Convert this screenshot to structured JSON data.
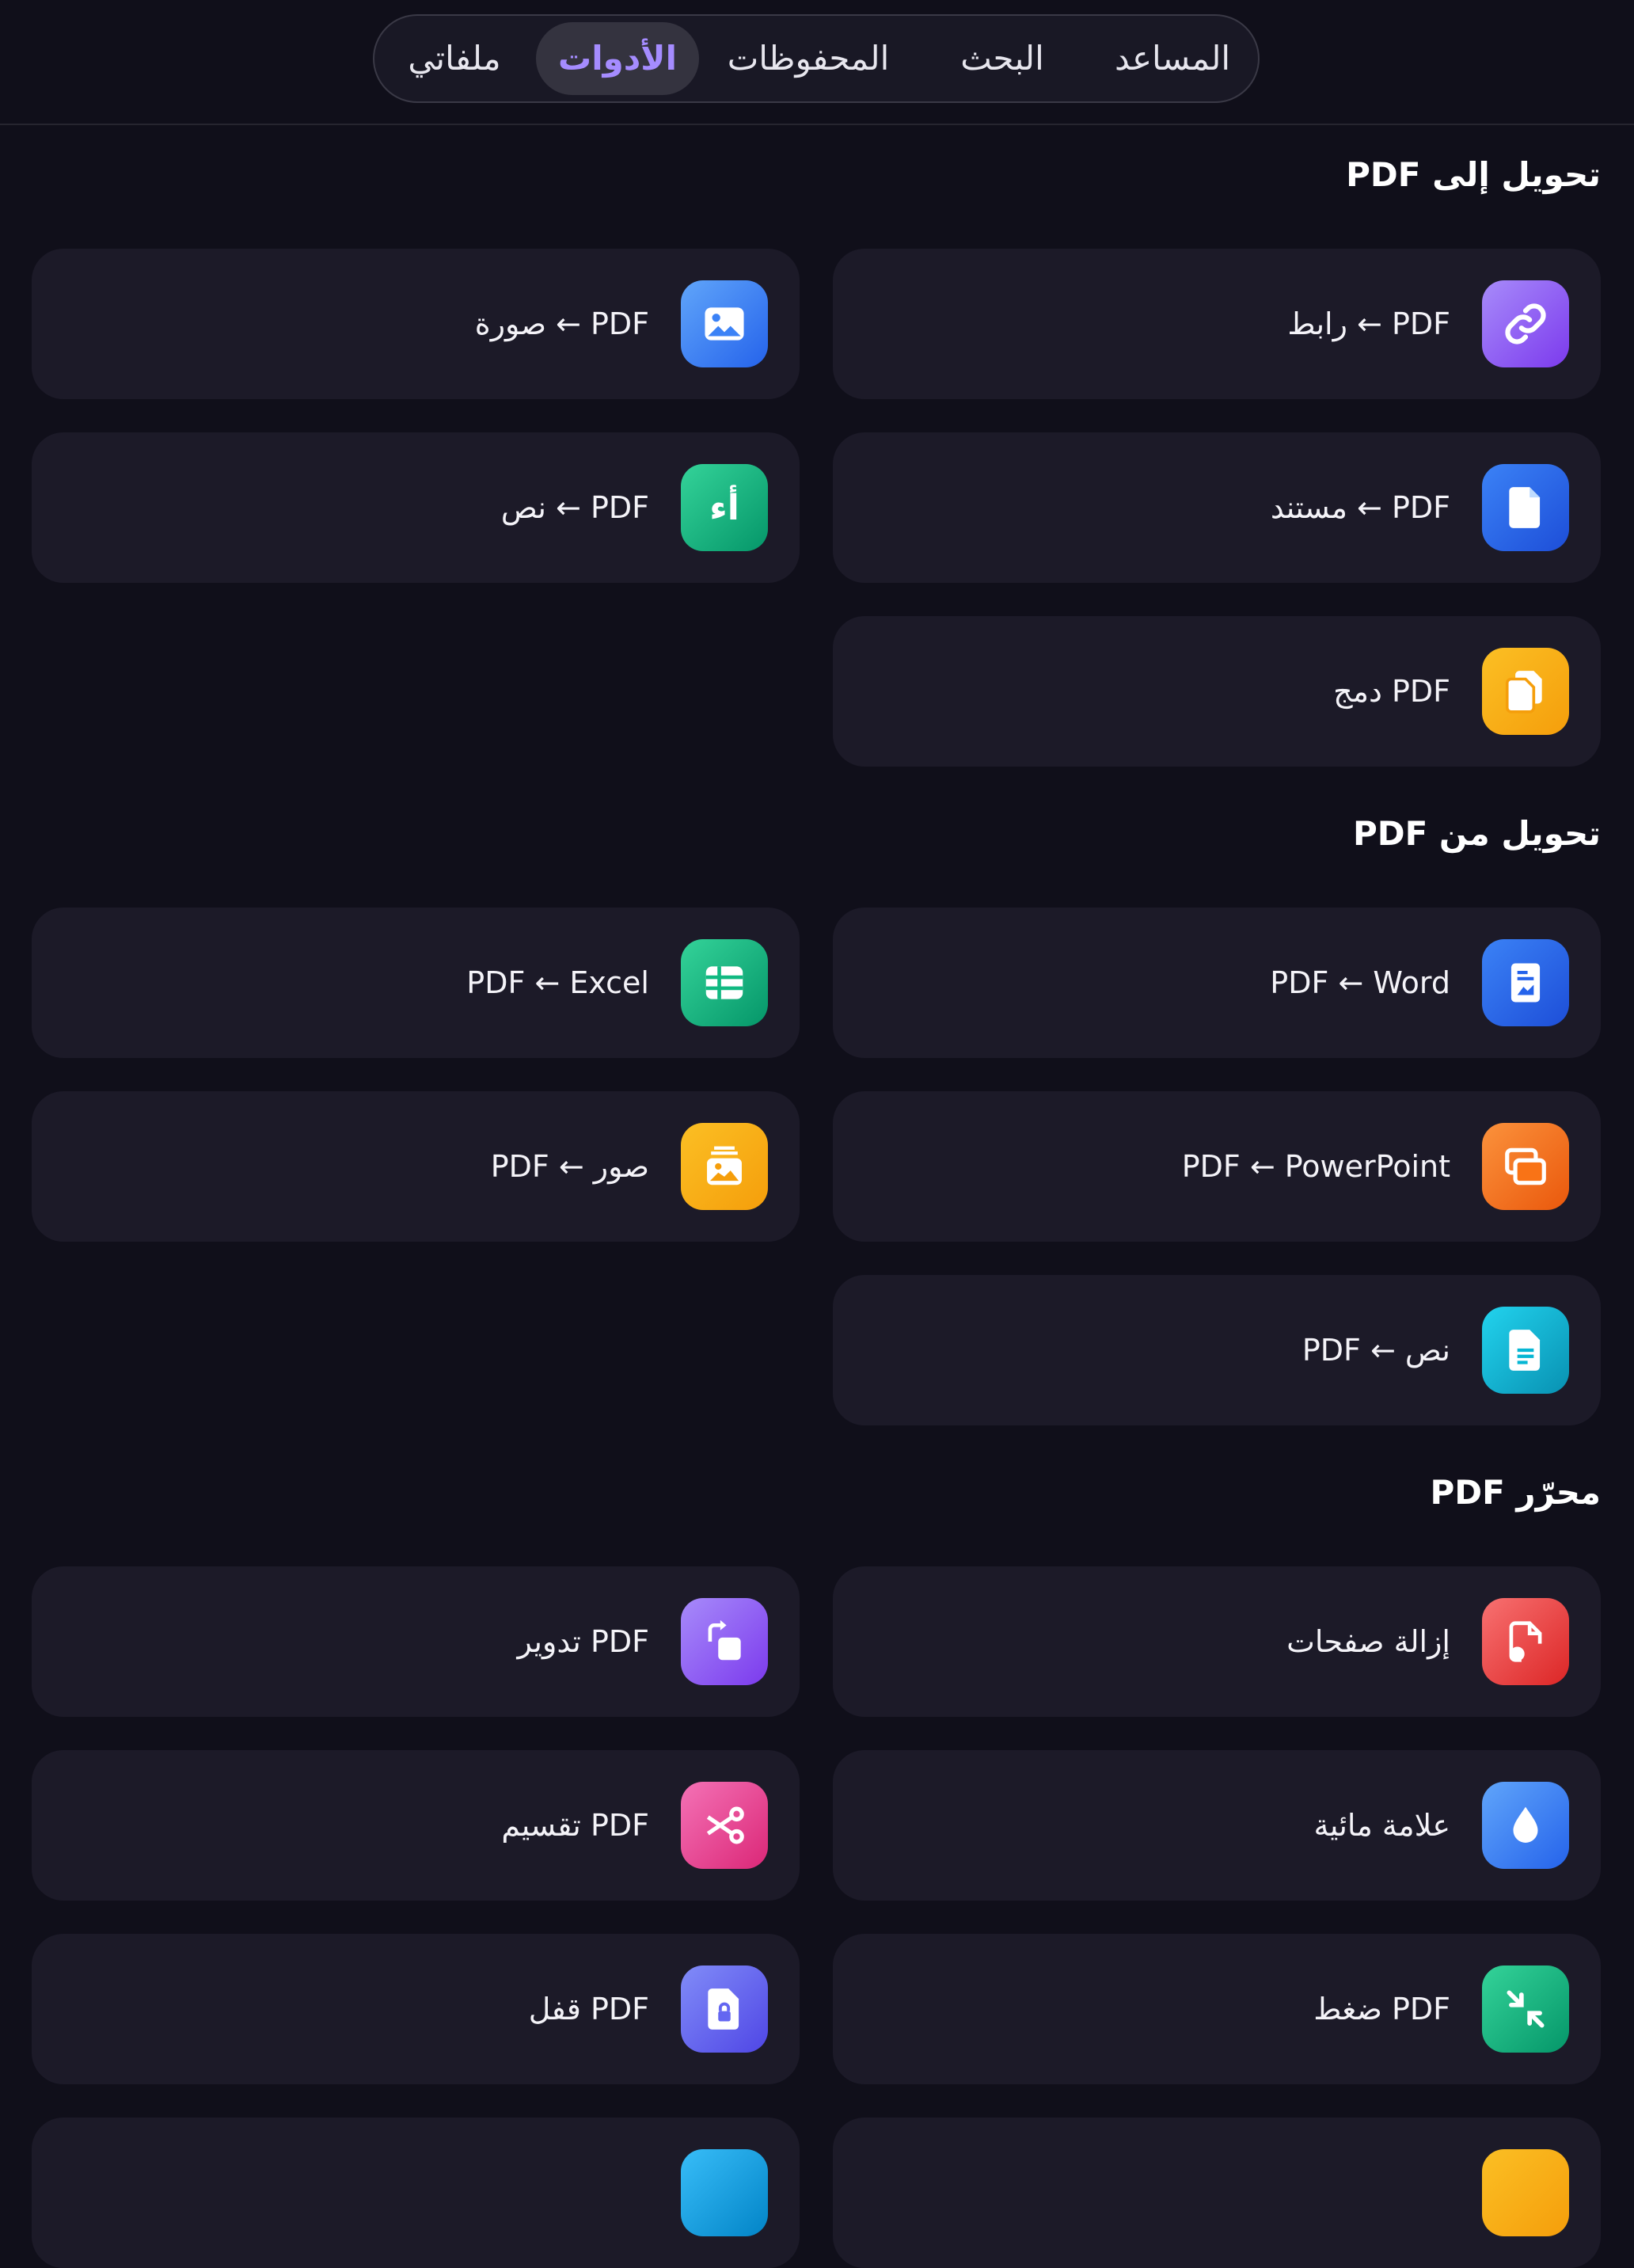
{
  "nav": {
    "tabs": [
      {
        "label": "المساعد",
        "active": false
      },
      {
        "label": "البحث",
        "active": false
      },
      {
        "label": "المحفوظات",
        "active": false
      },
      {
        "label": "الأدوات",
        "active": true
      },
      {
        "label": "ملفاتي",
        "active": false
      }
    ],
    "accent_color": "#a58cff"
  },
  "sections": [
    {
      "title": "تحويل إلى PDF",
      "tools": [
        {
          "label": "رابط ← PDF",
          "icon": "link-icon",
          "color": "#8b5cf6"
        },
        {
          "label": "صورة ← PDF",
          "icon": "image-icon",
          "color": "#3b82f6"
        },
        {
          "label": "مستند ← PDF",
          "icon": "document-icon",
          "color": "#2563eb"
        },
        {
          "label": "نص ← PDF",
          "icon": "text-icon",
          "color": "#10b981",
          "glyph": "أء"
        },
        {
          "label": "دمج PDF",
          "icon": "merge-documents-icon",
          "color": "#f59e0b"
        }
      ]
    },
    {
      "title": "تحويل من PDF",
      "tools": [
        {
          "label": "PDF ← Word",
          "icon": "word-document-icon",
          "color": "#2563eb"
        },
        {
          "label": "PDF ← Excel",
          "icon": "spreadsheet-icon",
          "color": "#10b981"
        },
        {
          "label": "PDF ← PowerPoint",
          "icon": "slides-icon",
          "color": "#f97316"
        },
        {
          "label": "PDF ← صور",
          "icon": "images-stack-icon",
          "color": "#f59e0b"
        },
        {
          "label": "PDF ← نص",
          "icon": "text-file-icon",
          "color": "#06b6d4"
        }
      ]
    },
    {
      "title": "محرّر PDF",
      "tools": [
        {
          "label": "إزالة صفحات",
          "icon": "remove-pages-icon",
          "color": "#ef4444"
        },
        {
          "label": "تدوير PDF",
          "icon": "rotate-icon",
          "color": "#8b5cf6"
        },
        {
          "label": "علامة مائية",
          "icon": "water-drop-icon",
          "color": "#3b82f6"
        },
        {
          "label": "تقسيم PDF",
          "icon": "scissors-icon",
          "color": "#ec4899"
        },
        {
          "label": "ضغط PDF",
          "icon": "compress-icon",
          "color": "#10b981"
        },
        {
          "label": "قفل PDF",
          "icon": "lock-file-icon",
          "color": "#6366f1"
        },
        {
          "label": "",
          "icon": "partial-icon",
          "color": "#f59e0b"
        },
        {
          "label": "",
          "icon": "partial-icon",
          "color": "#38bdf8"
        }
      ]
    }
  ]
}
